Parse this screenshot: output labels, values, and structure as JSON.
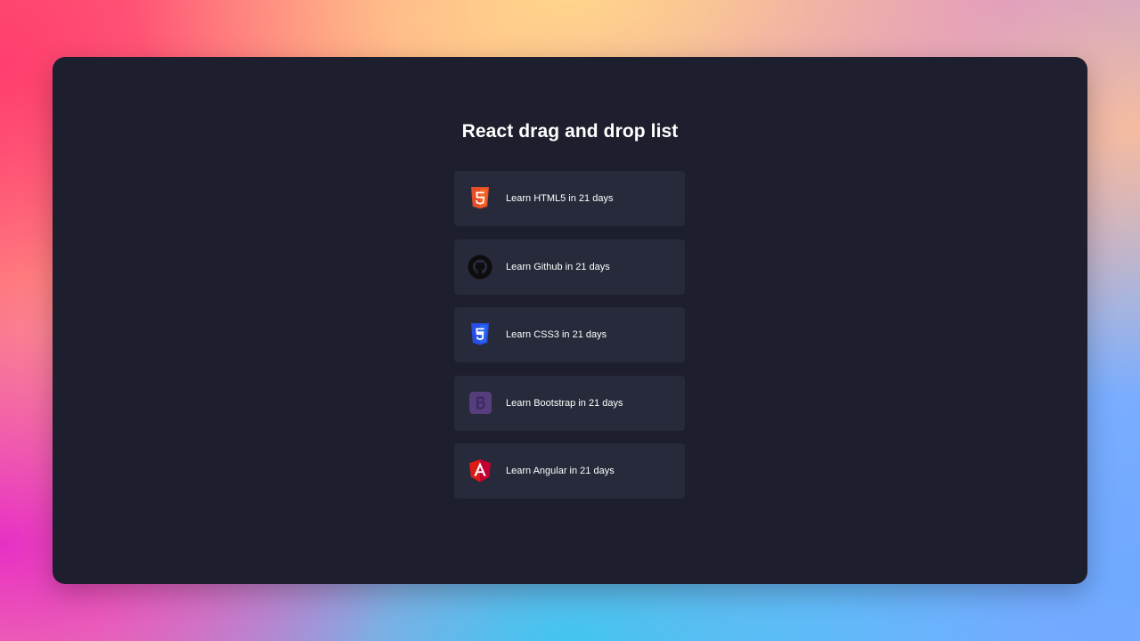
{
  "app": {
    "title": "React drag and drop list"
  },
  "list": {
    "items": [
      {
        "label": "Learn HTML5 in 21 days",
        "icon": "html5-icon",
        "color": "#e44d26"
      },
      {
        "label": "Learn Github in 21 days",
        "icon": "github-icon",
        "color": "#0d0d0d"
      },
      {
        "label": "Learn CSS3 in 21 days",
        "icon": "css3-icon",
        "color": "#264de4"
      },
      {
        "label": "Learn Bootstrap in 21 days",
        "icon": "bootstrap-icon",
        "color": "#563d7c"
      },
      {
        "label": "Learn Angular in 21 days",
        "icon": "angular-icon",
        "color": "#dd1b16"
      }
    ]
  }
}
